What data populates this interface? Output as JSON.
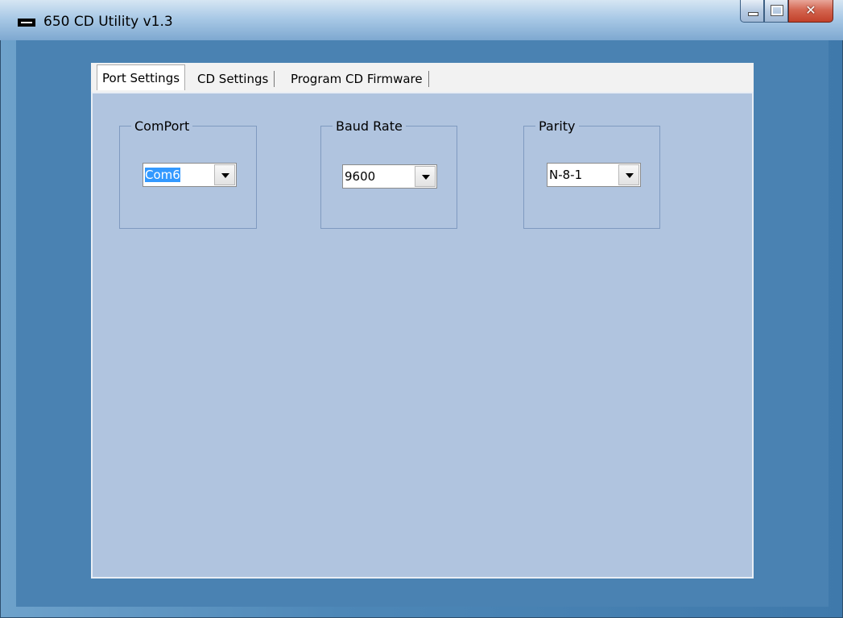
{
  "window": {
    "title": "650 CD Utility v1.3"
  },
  "tabs": [
    {
      "label": "Port Settings",
      "active": true
    },
    {
      "label": "CD Settings",
      "active": false
    },
    {
      "label": "Program CD Firmware",
      "active": false
    }
  ],
  "groups": {
    "comport": {
      "legend": "ComPort",
      "value": "Com6"
    },
    "baud": {
      "legend": "Baud Rate",
      "value": "9600"
    },
    "parity": {
      "legend": "Parity",
      "value": "N-8-1"
    }
  },
  "icons": {
    "app": "window-icon",
    "minimize": "minimize-icon",
    "maximize": "maximize-icon",
    "close": "close-icon",
    "dropdown": "chevron-down-icon"
  }
}
